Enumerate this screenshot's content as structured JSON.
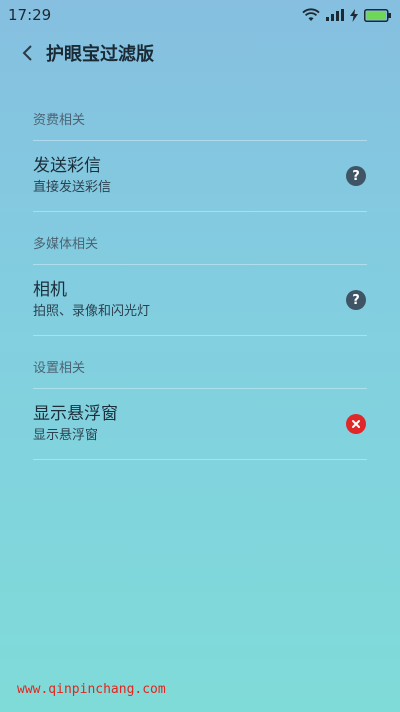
{
  "status_bar": {
    "time": "17:29"
  },
  "header": {
    "title": "护眼宝过滤版"
  },
  "sections": [
    {
      "header": "资费相关",
      "item": {
        "title": "发送彩信",
        "subtitle": "直接发送彩信",
        "status_icon": "help",
        "status_color": "#3f5566"
      }
    },
    {
      "header": "多媒体相关",
      "item": {
        "title": "相机",
        "subtitle": "拍照、录像和闪光灯",
        "status_icon": "help",
        "status_color": "#3f5566"
      }
    },
    {
      "header": "设置相关",
      "item": {
        "title": "显示悬浮窗",
        "subtitle": "显示悬浮窗",
        "status_icon": "close",
        "status_color": "#e02828"
      }
    }
  ],
  "watermark": "www.qinpinchang.com"
}
